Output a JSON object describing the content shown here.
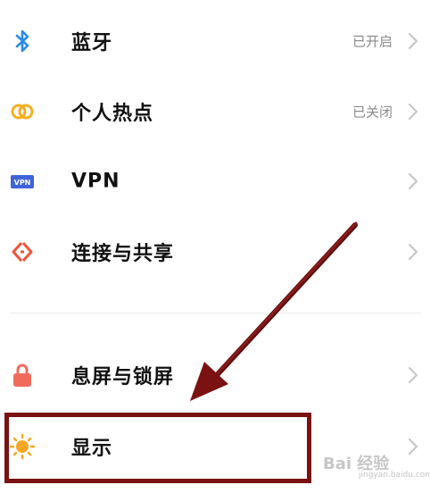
{
  "settings": {
    "items": [
      {
        "label": "蓝牙",
        "status": "已开启",
        "icon": "bluetooth-icon"
      },
      {
        "label": "个人热点",
        "status": "已关闭",
        "icon": "hotspot-icon"
      },
      {
        "label": "VPN",
        "status": "",
        "icon": "vpn-icon"
      },
      {
        "label": "连接与共享",
        "status": "",
        "icon": "connection-share-icon"
      },
      {
        "label": "息屏与锁屏",
        "status": "",
        "icon": "lock-icon"
      },
      {
        "label": "显示",
        "status": "",
        "icon": "brightness-icon"
      }
    ],
    "vpn_badge": "VPN"
  },
  "watermark": {
    "text": "Bai 经验",
    "sub": "jingyan.baidu.com"
  },
  "colors": {
    "annotation": "#7a1212",
    "bluetooth": "#2a8be8",
    "hotspot": "#f2b01e",
    "vpn": "#3f63d8",
    "connection": "#f0533b",
    "lock": "#f06b5c",
    "brightness": "#f5a623"
  }
}
